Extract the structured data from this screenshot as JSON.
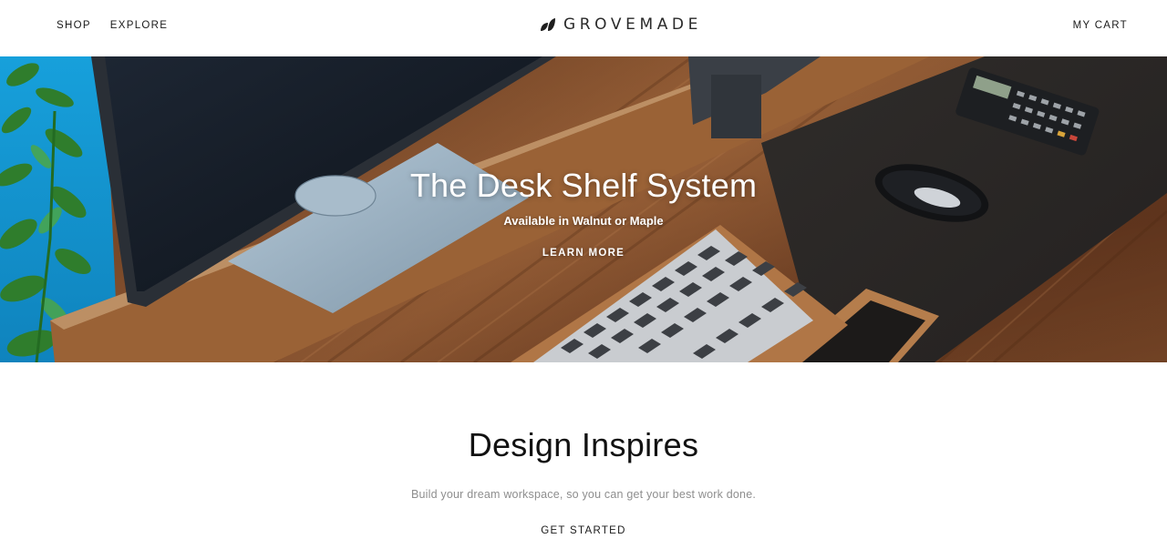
{
  "header": {
    "nav": {
      "shop": "SHOP",
      "explore": "EXPLORE"
    },
    "logo_text": "GROVEMADE",
    "cart": "MY CART"
  },
  "hero": {
    "title": "The Desk Shelf System",
    "subtitle": "Available in Walnut or Maple",
    "cta": "LEARN MORE"
  },
  "intro": {
    "title": "Design Inspires",
    "text": "Build your dream workspace, so you can get your best work done.",
    "cta": "GET STARTED"
  },
  "colors": {
    "text": "#1a1a1a",
    "muted_text": "#8e8e8e",
    "hero_text": "#ffffff",
    "walnut": "#6b4126",
    "blue_wall": "#1aa3d9",
    "leather_pad": "#2b2826"
  }
}
